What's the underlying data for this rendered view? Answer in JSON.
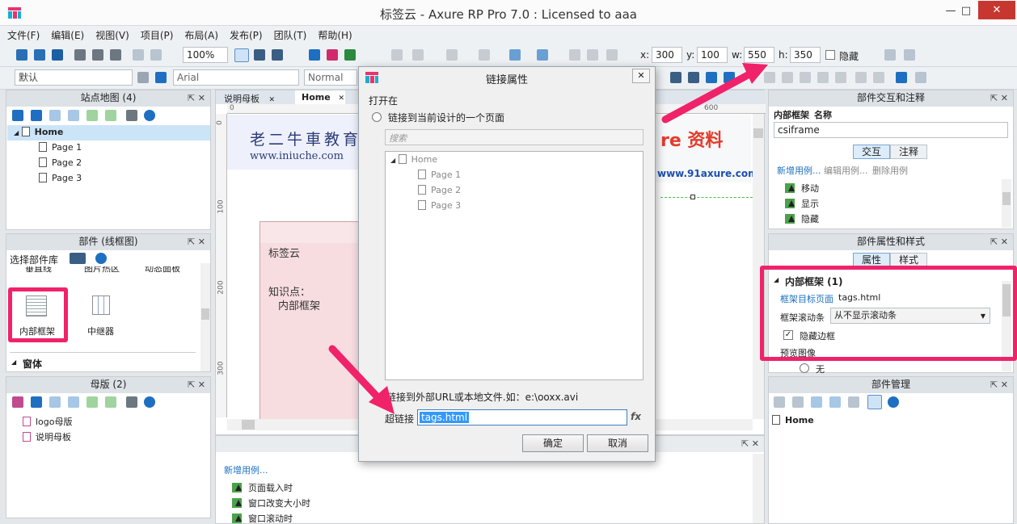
{
  "window": {
    "title": "标签云 - Axure RP Pro 7.0 : Licensed to aaa",
    "min": "—",
    "max": "□",
    "close": "✕"
  },
  "menu": [
    "文件(F)",
    "编辑(E)",
    "视图(V)",
    "项目(P)",
    "布局(A)",
    "发布(P)",
    "团队(T)",
    "帮助(H)"
  ],
  "toolbar": {
    "zoom": "100%",
    "x_label": "x:",
    "x_value": "300",
    "y_label": "y:",
    "y_value": "100",
    "w_label": "w:",
    "w_value": "550",
    "h_label": "h:",
    "h_value": "350",
    "hide_label": "隐藏",
    "style_select": "默认",
    "font_select": "Arial",
    "weight_select": "Normal"
  },
  "sitemap": {
    "title": "站点地图 (4)",
    "pin": "⇱ ✕",
    "root": "Home",
    "pages": [
      "Page 1",
      "Page 2",
      "Page 3"
    ]
  },
  "widgets": {
    "title": "部件 (线框图)",
    "pin": "⇱ ✕",
    "library_select": "选择部件库",
    "cut_labels": [
      "垂直线",
      "图片热区",
      "动态面板"
    ],
    "items": [
      {
        "label": "内部框架"
      },
      {
        "label": "中继器"
      }
    ],
    "section": "窗体"
  },
  "masters": {
    "title": "母版 (2)",
    "pin": "⇱ ✕",
    "items": [
      "logo母版",
      "说明母板"
    ]
  },
  "tabs": [
    {
      "label": "说明母板",
      "close": "✕"
    },
    {
      "label": "Home",
      "close": "✕"
    }
  ],
  "ruler": {
    "zero": "0",
    "mark_600": "600",
    "v_marks": [
      "0",
      "100",
      "200",
      "300"
    ]
  },
  "canvas": {
    "banner_left_text": "老二牛車教育",
    "banner_left_url": "www.iniuche.com",
    "banner_right_text": "re 资料",
    "banner_right_url": "www.91axure.com",
    "frame_title": "标签云",
    "frame_line1": "知识点：",
    "frame_line2": "内部框架"
  },
  "dialog": {
    "title": "链接属性",
    "close": "✕",
    "open_in": "打开在",
    "radio_page": "链接到当前设计的一个页面",
    "search_placeholder": "搜索",
    "tree_root": "Home",
    "tree_pages": [
      "Page 1",
      "Page 2",
      "Page 3"
    ],
    "external_hint": "链接到外部URL或本地文件.如：e:\\ooxx.avi",
    "hyperlink_label": "超链接",
    "hyperlink_value": "tags.html",
    "fx": "fx",
    "ok": "确定",
    "cancel": "取消"
  },
  "interactions": {
    "title": "部件交互和注释",
    "pin": "⇱ ✕",
    "name_label": "内部框架",
    "name_col": "名称",
    "name_value": "csiframe",
    "tab_interact": "交互",
    "tab_notes": "注释",
    "actions": [
      "新增用例...",
      "编辑用例...",
      "删除用例"
    ],
    "events": [
      "移动",
      "显示",
      "隐藏"
    ]
  },
  "props": {
    "title": "部件属性和样式",
    "pin": "⇱ ✕",
    "tab_props": "属性",
    "tab_style": "样式",
    "section": "内部框架 (1)",
    "target_label": "框架目标页面",
    "target_value": "tags.html",
    "scroll_label": "框架滚动条",
    "scroll_value": "从不显示滚动条",
    "hide_border_label": "隐藏边框",
    "preview_label": "预览图像",
    "none_label": "无"
  },
  "manager": {
    "title": "部件管理",
    "pin": "⇱ ✕",
    "root": "Home"
  },
  "page_interactions": {
    "pin": "⇱ ✕",
    "new_case": "新增用例...",
    "events": [
      "页面载入时",
      "窗口改变大小时",
      "窗口滚动时"
    ]
  },
  "colors": {
    "highlight": "#f0226a",
    "accent": "#1a70c2",
    "selection": "#cce4f7"
  }
}
